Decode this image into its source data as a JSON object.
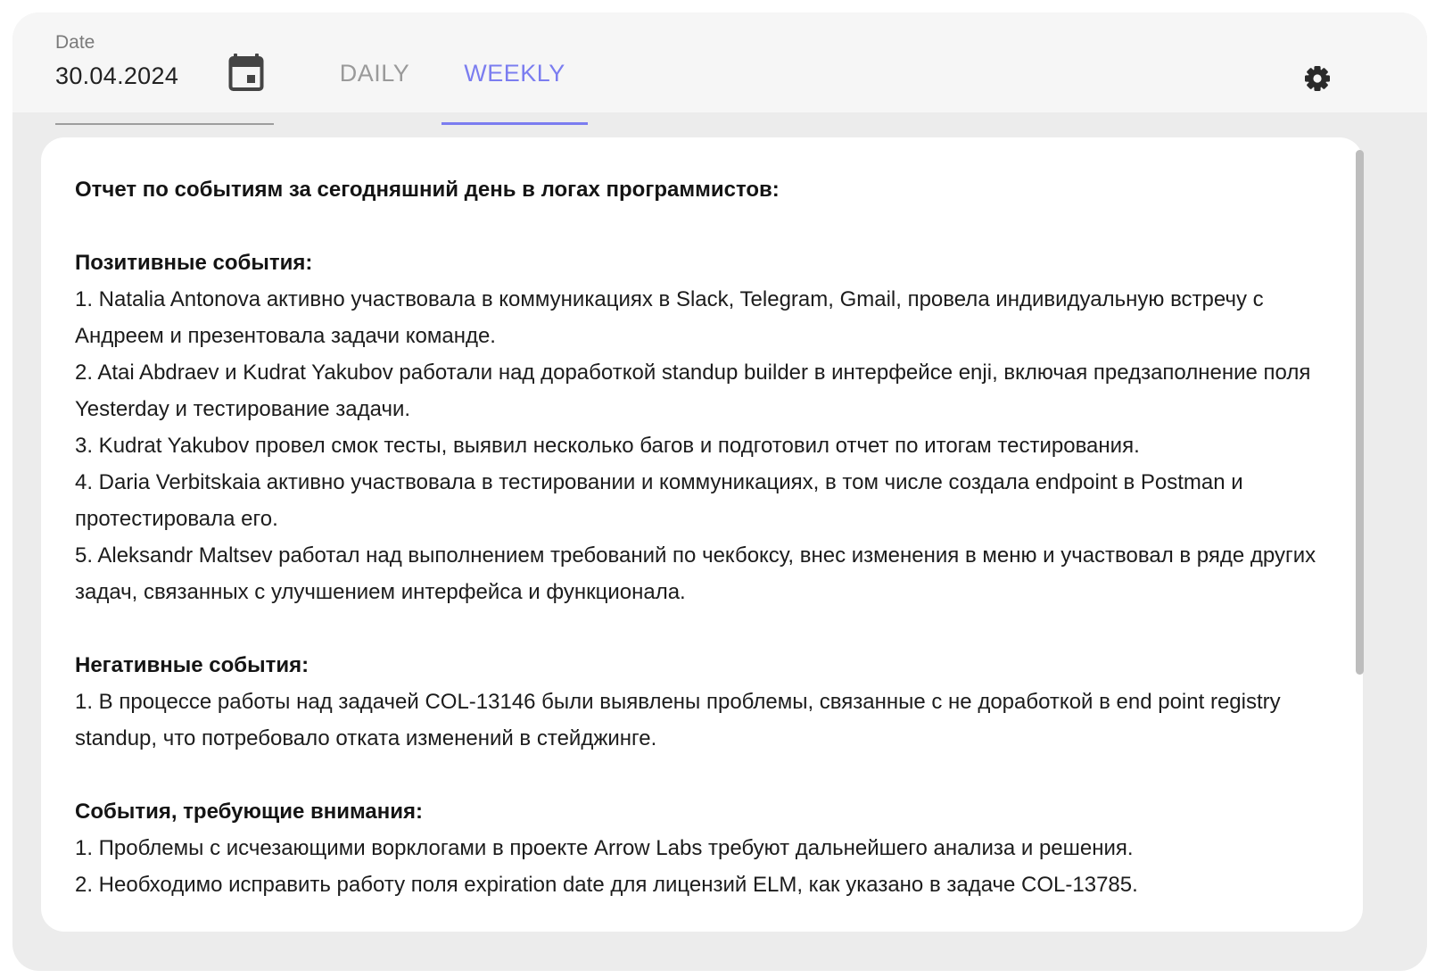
{
  "date_field": {
    "label": "Date",
    "value": "30.04.2024"
  },
  "icons": {
    "calendar": "calendar-icon",
    "settings": "gear-icon"
  },
  "tabs": [
    {
      "label": "DAILY",
      "active": false
    },
    {
      "label": "WEEKLY",
      "active": true
    }
  ],
  "colors": {
    "accent": "#7b7df0",
    "inactive_tab": "#9a9a9a",
    "panel_bg": "#ececec",
    "card_bg": "#ffffff"
  },
  "report": {
    "title": "Отчет по событиям за сегодняшний день в логах программистов:",
    "sections": [
      {
        "heading": "Позитивные события:",
        "items": [
          "1. Natalia Antonova активно участвовала в коммуникациях в Slack, Telegram, Gmail, провела индивидуальную встречу с Андреем и презентовала задачи команде.",
          "2. Atai Abdraev и Kudrat Yakubov работали над доработкой standup builder в интерфейсе enji, включая предзаполнение поля Yesterday и тестирование задачи.",
          "3. Kudrat Yakubov провел смок тесты, выявил несколько багов и подготовил отчет по итогам тестирования.",
          "4. Daria Verbitskaia активно участвовала в тестировании и коммуникациях, в том числе создала endpoint в Postman и протестировала его.",
          "5. Aleksandr Maltsev работал над выполнением требований по чекбоксу, внес изменения в меню и участвовал в ряде других задач, связанных с улучшением интерфейса и функционала."
        ]
      },
      {
        "heading": "Негативные события:",
        "items": [
          "1. В процессе работы над задачей COL-13146 были выявлены проблемы, связанные с не доработкой в end point registry standup, что потребовало отката изменений в стейджинге."
        ]
      },
      {
        "heading": "События, требующие внимания:",
        "items": [
          "1. Проблемы с исчезающими ворклогами в проекте Arrow Labs требуют дальнейшего анализа и решения.",
          "2. Необходимо исправить работу поля expiration date для лицензий ELM, как указано в задаче COL-13785."
        ]
      }
    ]
  }
}
